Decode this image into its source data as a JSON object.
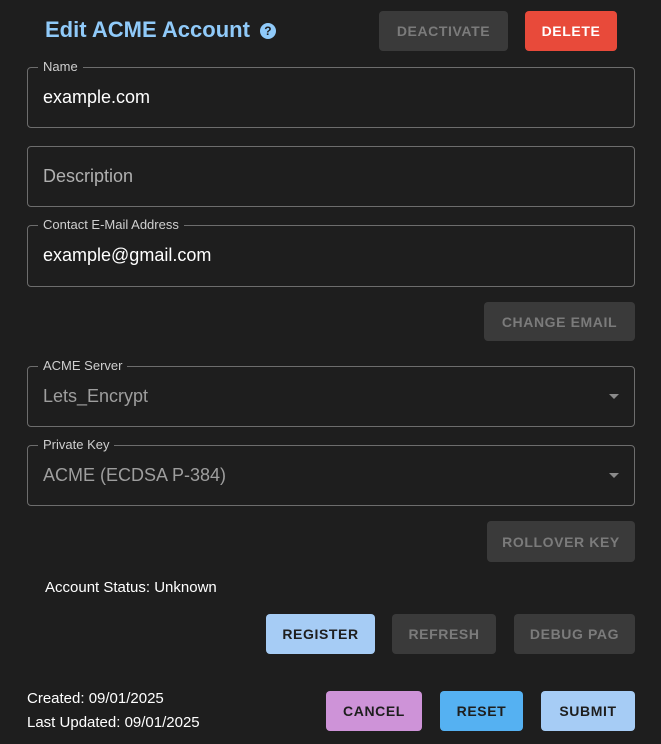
{
  "header": {
    "title": "Edit ACME Account",
    "deactivate_label": "DEACTIVATE",
    "delete_label": "DELETE"
  },
  "fields": {
    "name": {
      "label": "Name",
      "value": "example.com"
    },
    "description": {
      "placeholder": "Description"
    },
    "email": {
      "label": "Contact E-Mail Address",
      "value": "example@gmail.com"
    },
    "acme_server": {
      "label": "ACME Server",
      "value": "Lets_Encrypt"
    },
    "private_key": {
      "label": "Private Key",
      "value": "ACME (ECDSA P-384)"
    }
  },
  "buttons": {
    "change_email": "CHANGE EMAIL",
    "rollover_key": "ROLLOVER KEY",
    "register": "REGISTER",
    "refresh": "REFRESH",
    "debug": "DEBUG PAG",
    "cancel": "CANCEL",
    "reset": "RESET",
    "submit": "SUBMIT"
  },
  "status": {
    "account_status": "Account Status: Unknown",
    "created": "Created: 09/01/2025",
    "last_updated": "Last Updated: 09/01/2025"
  },
  "colors": {
    "title": "#90caf9",
    "delete": "#e84a3a",
    "submit": "#a6ccf5",
    "reset": "#55b1f2",
    "cancel": "#ce93d8"
  }
}
